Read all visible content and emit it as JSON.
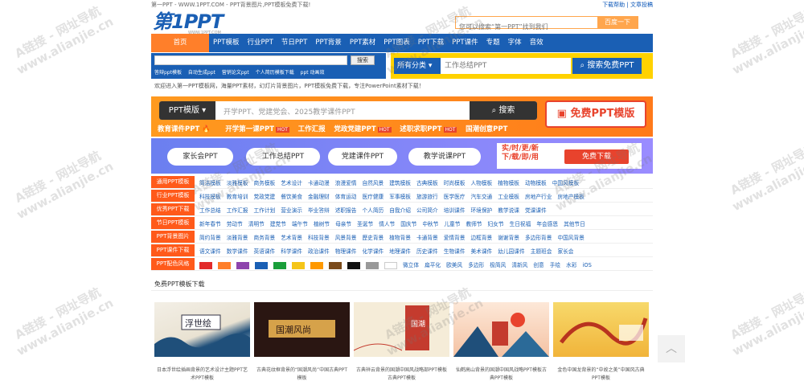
{
  "topbar": {
    "left": "第一PPT - WWW.1PPT.COM - PPT背景图片,PPT模板免费下载!",
    "right": "下载帮助 | 文章投稿"
  },
  "logo": {
    "main": "第1PPT",
    "sub": "WWW.1PPT.COM"
  },
  "header_search": {
    "placeholder": "您可以搜索“第一PPT”找到我们",
    "button": "百度一下"
  },
  "nav": [
    "首页",
    "PPT模板",
    "行业PPT",
    "节日PPT",
    "PPT背景",
    "PPT素材",
    "PPT图表",
    "PPT下载",
    "PPT课件",
    "专题",
    "字体",
    "音效"
  ],
  "site_search": {
    "button": "搜索",
    "links": [
      "答辩ppt模板",
      "自动生成ppt",
      "营销论文ppt",
      "个人简历模板下载",
      "ppt 动画效"
    ]
  },
  "ad_search": {
    "select": "所有分类",
    "placeholder": "工作总结PPT",
    "button": "搜索免费PPT"
  },
  "welcome": "欢迎进入第一PPT模板网，海量PPT素材，幻灯片背景图片，PPT模板免费下载，专注PowerPoint素材下载！",
  "banner": {
    "select": "PPT模版",
    "placeholder": "开学PPT、党建党会、2025教学课件PPT",
    "search": "搜索",
    "free": "免费PPT模版",
    "hot_tag": "HOT",
    "hot": [
      "教育课件PPT",
      "开学第一课PPT",
      "工作汇报",
      "党政党建PPT",
      "述职求职PPT",
      "国潮创意PPT"
    ]
  },
  "blue_banner": {
    "pills": [
      "家长会PPT",
      "工作总结PPT",
      "党建课件PPT",
      "教学说课PPT"
    ],
    "ad_line1": "实/时/更/新",
    "ad_line2": "下/载/即/用",
    "ad_button": "免费下载",
    "ad_small": "更多精美PPT"
  },
  "categories": [
    {
      "label": "通用PPT模板",
      "items": [
        "简洁模板",
        "淡雅模板",
        "商务模板",
        "艺术设计",
        "卡通动漫",
        "浪漫爱情",
        "自然风景",
        "建筑模板",
        "古典模板",
        "时尚模板",
        "人物模板",
        "植物模板",
        "动物模板",
        "中国风模板"
      ]
    },
    {
      "label": "行业PPT模板",
      "items": [
        "科技模板",
        "教育培训",
        "党政党建",
        "餐饮美食",
        "金融理财",
        "体育运动",
        "医疗健康",
        "军事模板",
        "旅游旅行",
        "医学医疗",
        "汽车交通",
        "工业模板",
        "房地产行业",
        "房地产模板"
      ]
    },
    {
      "label": "优秀PPT下载",
      "items": [
        "工作总结",
        "工作汇报",
        "工作计划",
        "营业演示",
        "毕业答辩",
        "述职报告",
        "个人简历",
        "自我介绍",
        "公司简介",
        "培训课件",
        "环境保护",
        "教学说课",
        "党课课件"
      ]
    },
    {
      "label": "节日PPT模板",
      "items": [
        "新年春节",
        "劳动节",
        "清明节",
        "建党节",
        "端午节",
        "植树节",
        "母亲节",
        "圣诞节",
        "情人节",
        "国庆节",
        "中秋节",
        "儿童节",
        "教师节",
        "妇女节",
        "生日祝福",
        "年会感恩",
        "其他节日"
      ]
    },
    {
      "label": "PPT背景图片",
      "items": [
        "简约背景",
        "淡雅背景",
        "商务背景",
        "艺术背景",
        "科技背景",
        "风景背景",
        "歷史背景",
        "植物背景",
        "卡通背景",
        "爱情背景",
        "边框背景",
        "谢谢背景",
        "多边形背景",
        "中国风背景"
      ]
    },
    {
      "label": "PPT课件下载",
      "items": [
        "语文课件",
        "数学课件",
        "英语课件",
        "科学课件",
        "政治课件",
        "物理课件",
        "化学课件",
        "地理课件",
        "历史课件",
        "生物课件",
        "美术课件",
        "幼儿园课件",
        "主题班会",
        "家长会"
      ]
    },
    {
      "label": "PPT配色风格",
      "items": [
        "微立体",
        "扁平化",
        "欧美风",
        "多边形",
        "极简风",
        "清新风",
        "创意",
        "手绘",
        "水彩",
        "iOS"
      ]
    }
  ],
  "swatches": [
    "#e22b2b",
    "#ff7f2a",
    "#8e44ad",
    "#1a5fb4",
    "#1a9e3a",
    "#f5c518",
    "#ff9900",
    "#7a4a1a",
    "#111111",
    "#999999",
    "#ffffff"
  ],
  "free_section": {
    "title": "免费PPT模板下载",
    "more": "更多"
  },
  "cards": [
    {
      "caption": "日本浮世绘插画背景的艺术设计主题PPT艺术PPT模板"
    },
    {
      "caption": "古典花纹框背景的“国潮风尚”中国古典PPT模板"
    },
    {
      "caption": "古典祥云背景的国潮中国风战略部PPT模板古典PPT模板"
    },
    {
      "caption": "仙鹤高山背景的国潮中国风战略PPT模板古典PPT模板"
    },
    {
      "caption": "金色中国龙背景的“中故之美”中国风古典PPT模板"
    }
  ],
  "watermark": {
    "line1": "A链接 - 网址导航",
    "line2": "www.alianjie.cn"
  },
  "totop": "︿"
}
